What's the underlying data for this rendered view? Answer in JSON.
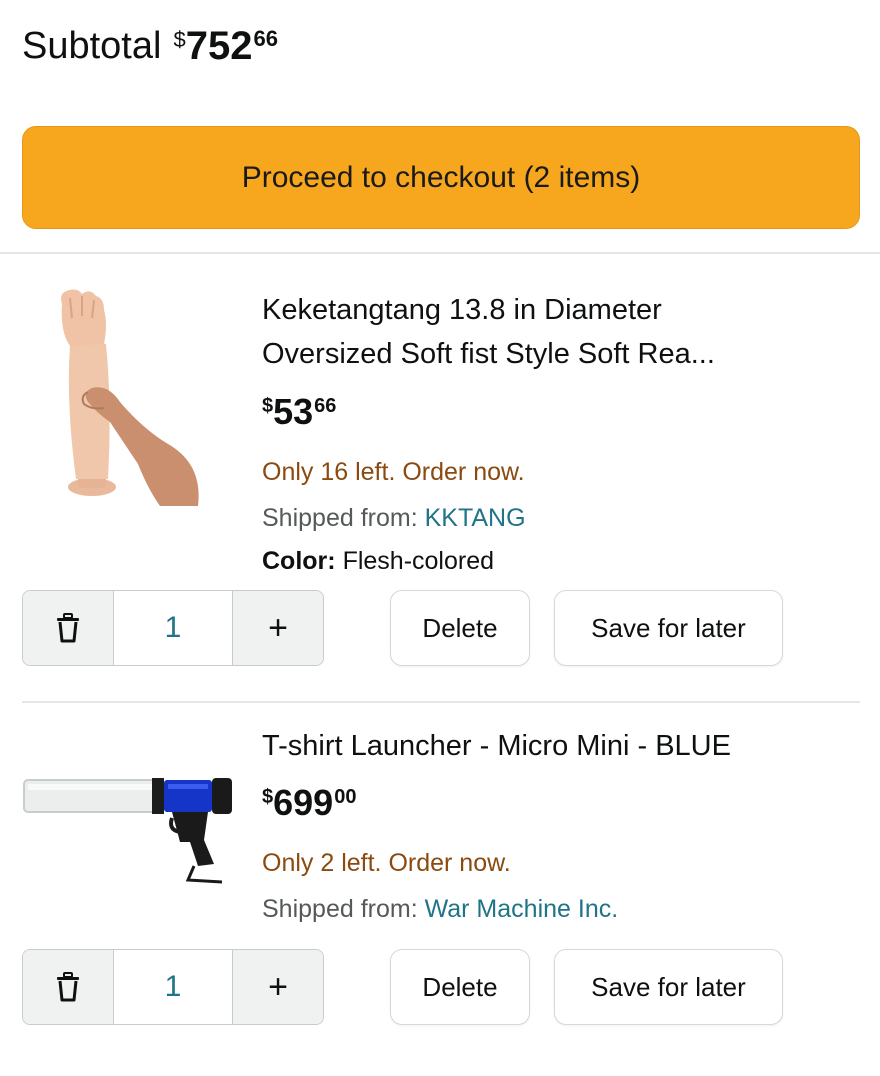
{
  "subtotal": {
    "label": "Subtotal",
    "currency": "$",
    "whole": "752",
    "fraction": "66"
  },
  "checkout_button": "Proceed to checkout (2 items)",
  "items": [
    {
      "title_line1": "Keketangtang 13.8 in Diameter",
      "title_line2": "Oversized Soft fist Style Soft Rea...",
      "price": {
        "currency": "$",
        "whole": "53",
        "fraction": "66"
      },
      "stock": "Only 16 left. Order now.",
      "shipped_label": "Shipped from:",
      "seller": "KKTANG",
      "color_label": "Color:",
      "color_value": "Flesh-colored",
      "quantity": "1",
      "delete_label": "Delete",
      "save_label": "Save for later"
    },
    {
      "title_line1": "T-shirt Launcher - Micro Mini - BLUE",
      "price": {
        "currency": "$",
        "whole": "699",
        "fraction": "00"
      },
      "stock": "Only 2 left. Order now.",
      "shipped_label": "Shipped from:",
      "seller": "War Machine Inc.",
      "quantity": "1",
      "delete_label": "Delete",
      "save_label": "Save for later"
    }
  ],
  "icons": {
    "trash": "trash-icon",
    "plus": "+"
  },
  "colors": {
    "checkout_button": "#f7a71e",
    "stock_text": "#8a4a10",
    "seller_link": "#1f7488"
  }
}
